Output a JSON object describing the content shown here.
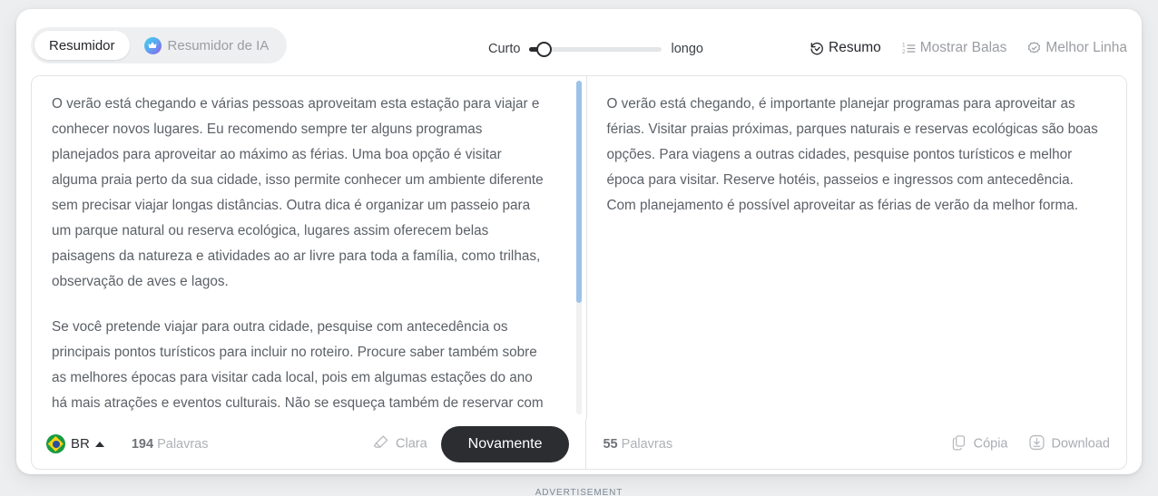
{
  "tabs": {
    "items": [
      {
        "label": "Resumidor",
        "active": true,
        "icon": null
      },
      {
        "label": "Resumidor de IA",
        "active": false,
        "icon": "crown-icon"
      }
    ]
  },
  "length_slider": {
    "min_label": "Curto",
    "max_label": "longo",
    "value_percent": 10
  },
  "toolbar_actions": [
    {
      "label": "Resumo",
      "icon": "summary-refresh-icon",
      "active": true
    },
    {
      "label": "Mostrar Balas",
      "icon": "numbered-list-icon",
      "active": false
    },
    {
      "label": "Melhor Linha",
      "icon": "badge-check-icon",
      "active": false
    }
  ],
  "source_panel": {
    "paragraphs": [
      "O verão está chegando e várias pessoas aproveitam esta estação para viajar e conhecer novos lugares. Eu recomendo sempre ter alguns programas planejados para aproveitar ao máximo as férias. Uma boa opção é visitar alguma praia perto da sua cidade, isso permite conhecer um ambiente diferente sem precisar viajar longas distâncias. Outra dica é organizar um passeio para um parque natural ou reserva ecológica, lugares assim oferecem belas paisagens da natureza e atividades ao ar livre para toda a família, como trilhas, observação de aves e lagos.",
      "Se você pretende viajar para outra cidade, pesquise com antecedência os principais pontos turísticos para incluir no roteiro. Procure saber também sobre as melhores épocas para visitar cada local, pois em algumas estações do ano há mais atrações e eventos culturais. Não se esqueça também de reservar com antecedência hotéis, passeios e ingressos para shows e museus, principalmente nos finais de semana e feriados quando há"
    ],
    "word_count_number": "194",
    "word_count_label": "Palavras",
    "language_code": "BR",
    "clear_label": "Clara",
    "again_label": "Novamente"
  },
  "result_panel": {
    "paragraphs": [
      "O verão está chegando, é importante planejar programas para aproveitar as férias. Visitar praias próximas, parques naturais e reservas ecológicas são boas opções. Para viagens a outras cidades, pesquise pontos turísticos e melhor época para visitar. Reserve hotéis, passeios e ingressos com antecedência. Com planejamento é possível aproveitar as férias de verão da melhor forma."
    ],
    "word_count_number": "55",
    "word_count_label": "Palavras",
    "actions": [
      {
        "label": "Cópia",
        "icon": "copy-icon"
      },
      {
        "label": "Download",
        "icon": "download-icon"
      }
    ]
  },
  "advertisement_label": "ADVERTISEMENT",
  "colors": {
    "accent_dark": "#2b2d31",
    "scrollbar_thumb": "#9dc2e8",
    "muted_text": "#a9acb1",
    "body_text": "#5c6167",
    "flag_green": "#179b43",
    "flag_yellow": "#f7d117",
    "flag_blue": "#2a4f9e"
  }
}
